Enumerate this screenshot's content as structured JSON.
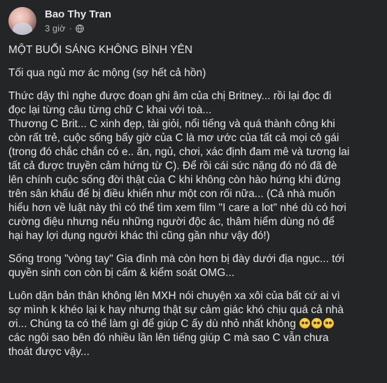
{
  "post": {
    "author": "Bao Thy Tran",
    "time": "3 giờ",
    "separator": "·",
    "audience_icon": "globe-icon",
    "paragraphs": [
      "MỘT BUỔI SÁNG KHÔNG BÌNH YÊN",
      "Tối qua ngủ mơ ác mộng (sợ hết cả hồn)",
      "Thức dậy thì nghe được đoạn ghi âm của chị Britney... rồi lại đọc đi\nđọc lại từng câu từng chữ C khai với toà...\nThương C Brit... C xinh đẹp, tài giỏi, nổi tiếng và quá thành công khi\ncòn rất trẻ, cuộc sống bấy giờ của C là mơ ước của tất cả mọi cô gái\n(trong đó chắc chắn có e.. ăn, ngủ, chơi, xác định đam mê và tương lai\ntất cả được truyền cảm hứng từ C). Để rồi cái sức nặng đó nó đã đè\nlên chính cuộc sống đời thật của C khi không còn hào hứng khi đứng\ntrên sân khấu để bị điều khiển như một con rối nữa... (Cả nhà muốn\nhiểu hơn về luật này thì có thể tìm xem film \"I care a lot\" nhé dù có hơi\ncường điệu nhưng nếu những người độc ác, thâm hiểm dùng nó để\nhại hay lợi dụng người khác thì cũng gần như vậy đó!)",
      "Sống trong \"vòng tay\" Gia đình mà còn hơn bị đày dưới địa ngục... tới\nquyền sinh con còn bị cấm & kiểm soát OMG..."
    ],
    "last_paragraph_before": "Luôn dặn bản thân không lên MXH nói chuyện xa xôi của bất cứ ai vì\nsợ mình k khéo lại k hay nhưng thật sự cảm giác khó chịu quá cả nhà\nơi... Chúng ta có thể làm gì để giúp C ấy dù nhỏ nhất không ",
    "last_paragraph_emojis": [
      "crying-face-emoji",
      "crying-face-emoji",
      "crying-face-emoji"
    ],
    "last_paragraph_after": "\ncác ngôi sao bên đó nhiều lần lên tiếng giúp C mà sao C vẫn chưa\nthoát được vậy..."
  }
}
